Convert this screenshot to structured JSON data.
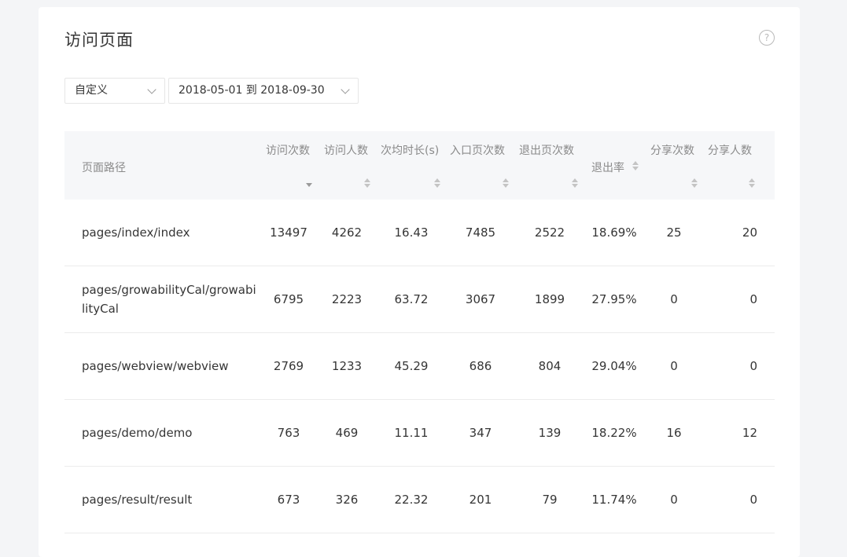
{
  "title": "访问页面",
  "help_symbol": "?",
  "filters": {
    "range_type": "自定义",
    "date_range": "2018-05-01 到 2018-09-30"
  },
  "table": {
    "columns": [
      "页面路径",
      "访问次数",
      "访问人数",
      "次均时长(s)",
      "入口页次数",
      "退出页次数",
      "退出率",
      "分享次数",
      "分享人数"
    ],
    "rows": [
      {
        "path": "pages/index/index",
        "visits": "13497",
        "visitors": "4262",
        "avg_duration": "16.43",
        "entry": "7485",
        "exit": "2522",
        "exit_rate": "18.69%",
        "shares": "25",
        "sharers": "20"
      },
      {
        "path": "pages/growabilityCal/growabilityCal",
        "visits": "6795",
        "visitors": "2223",
        "avg_duration": "63.72",
        "entry": "3067",
        "exit": "1899",
        "exit_rate": "27.95%",
        "shares": "0",
        "sharers": "0"
      },
      {
        "path": "pages/webview/webview",
        "visits": "2769",
        "visitors": "1233",
        "avg_duration": "45.29",
        "entry": "686",
        "exit": "804",
        "exit_rate": "29.04%",
        "shares": "0",
        "sharers": "0"
      },
      {
        "path": "pages/demo/demo",
        "visits": "763",
        "visitors": "469",
        "avg_duration": "11.11",
        "entry": "347",
        "exit": "139",
        "exit_rate": "18.22%",
        "shares": "16",
        "sharers": "12"
      },
      {
        "path": "pages/result/result",
        "visits": "673",
        "visitors": "326",
        "avg_duration": "22.32",
        "entry": "201",
        "exit": "79",
        "exit_rate": "11.74%",
        "shares": "0",
        "sharers": "0"
      }
    ]
  }
}
